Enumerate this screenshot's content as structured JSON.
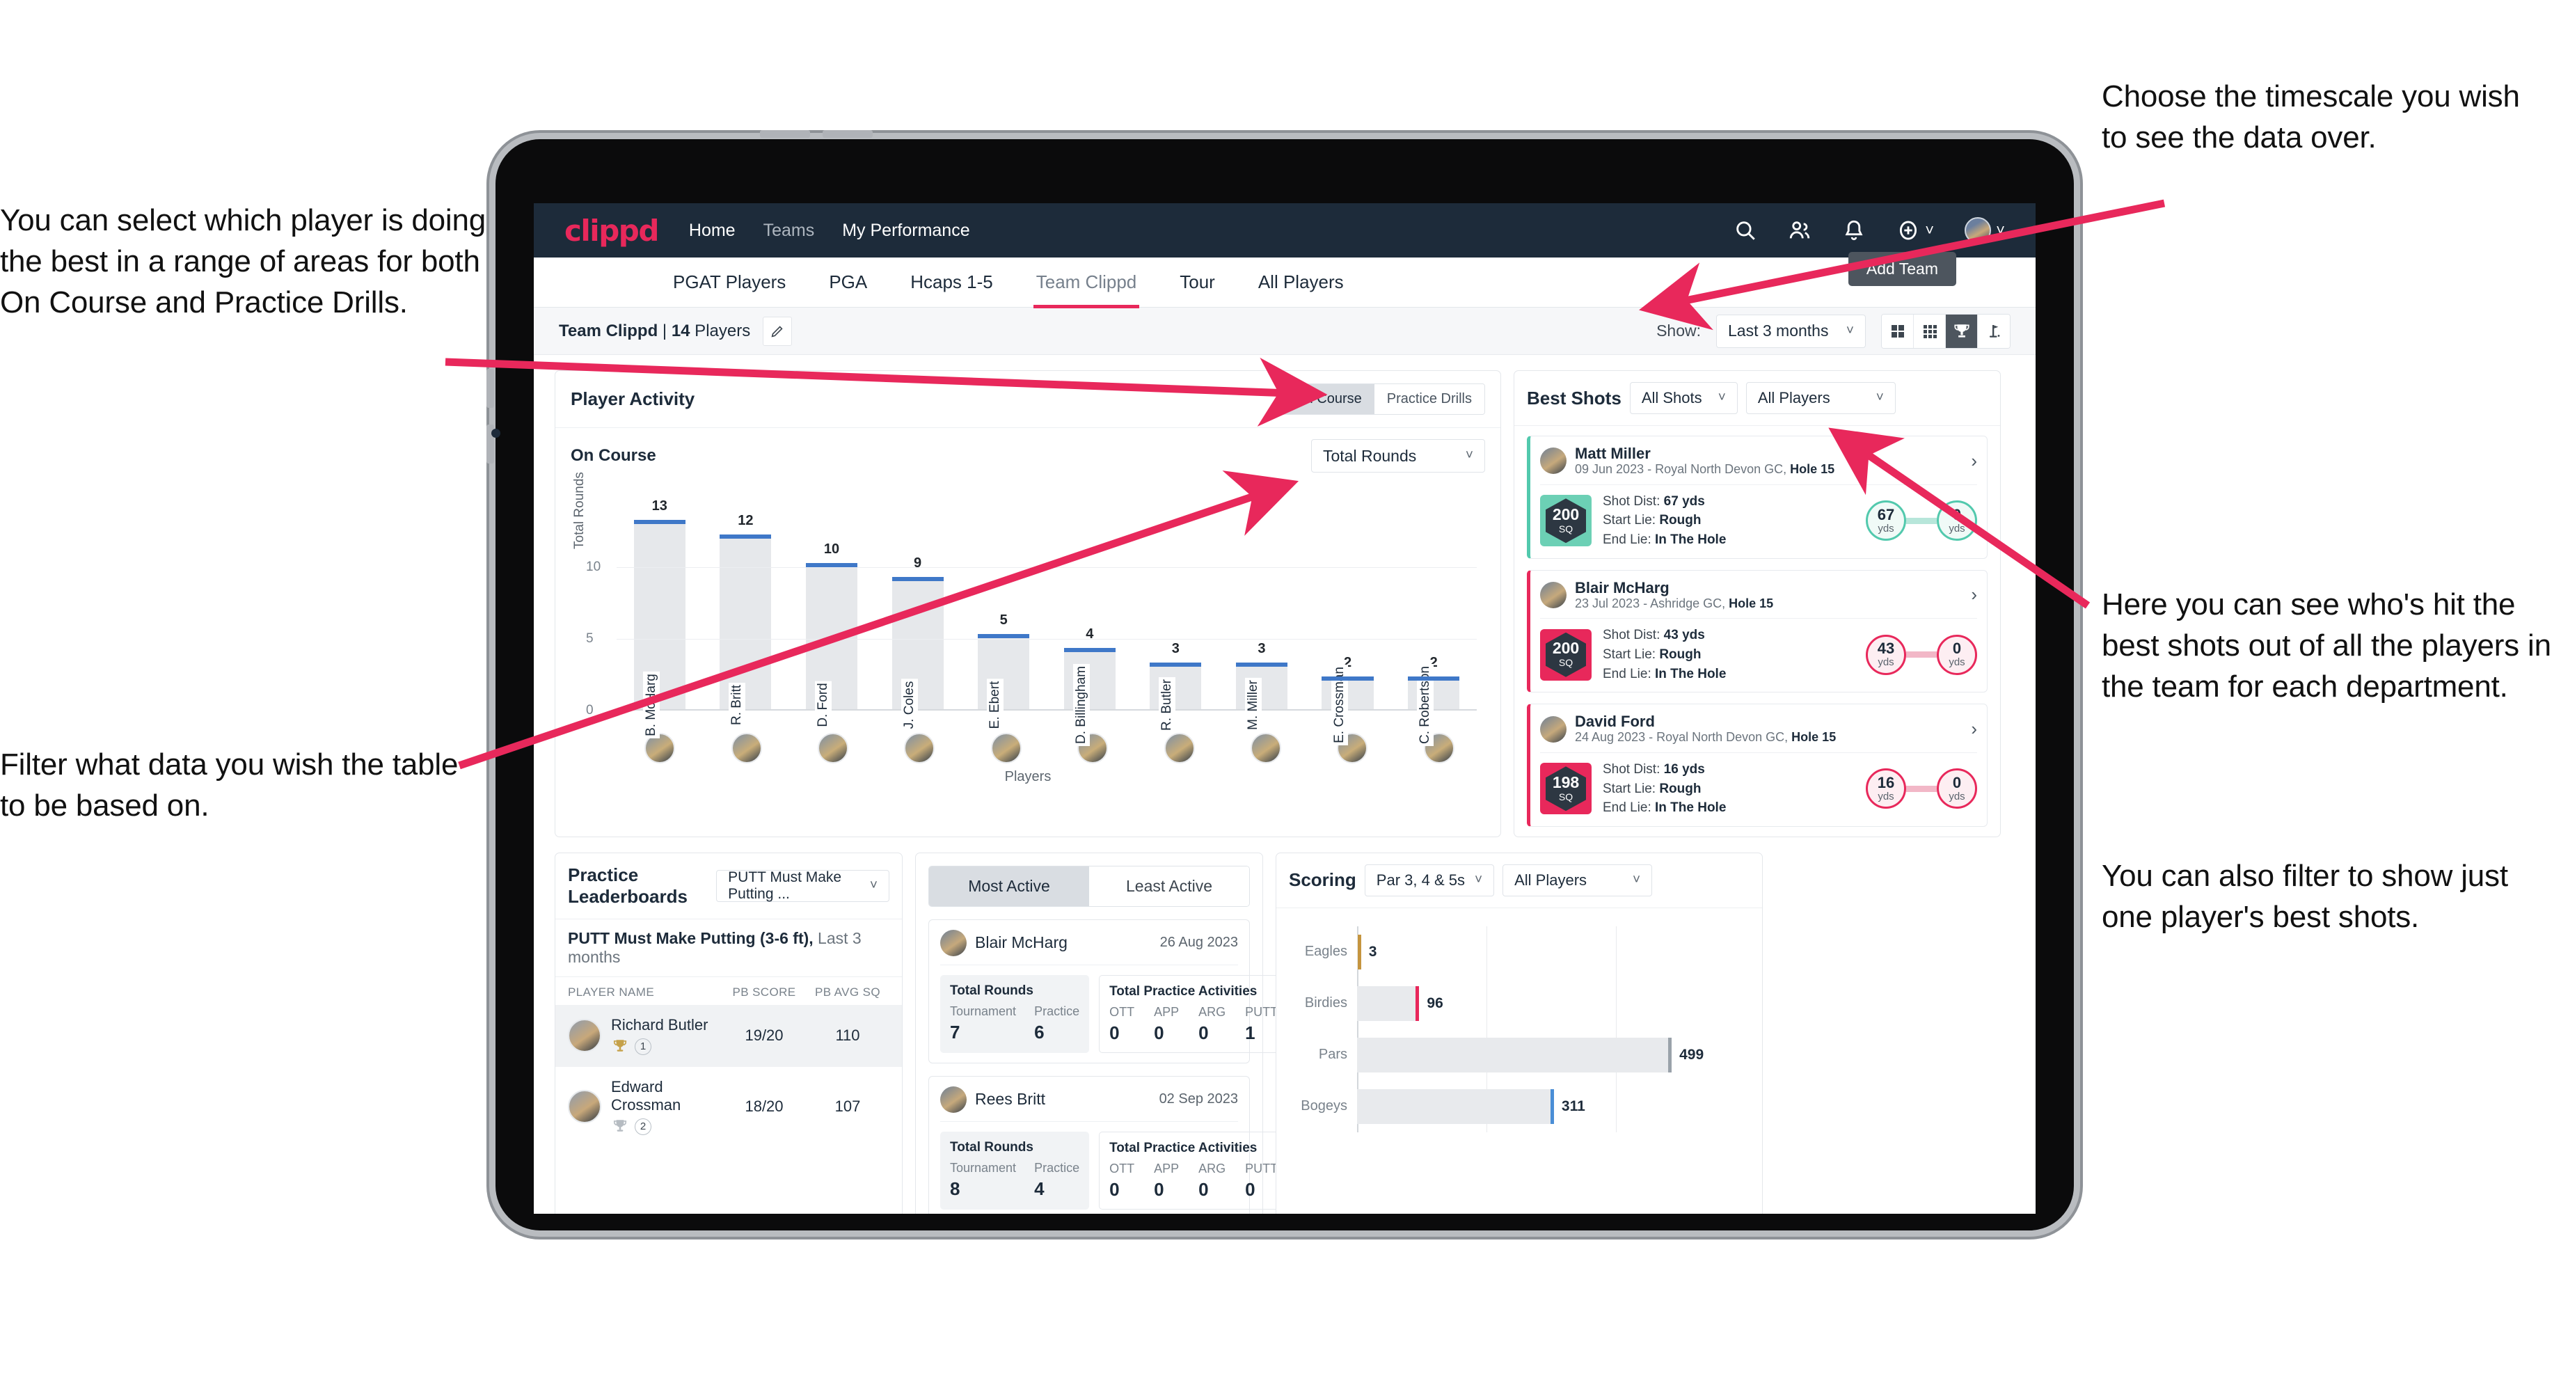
{
  "annotations": {
    "left_top": "You can select which player is doing the best in a range of areas for both On Course and Practice Drills.",
    "left_bottom": "Filter what data you wish the table to be based on.",
    "right_top": "Choose the timescale you wish to see the data over.",
    "right_mid": "Here you can see who's hit the best shots out of all the players in the team for each department.",
    "right_bottom": "You can also filter to show just one player's best shots."
  },
  "app": {
    "logo": "clippd",
    "nav": [
      {
        "label": "Home",
        "dim": false
      },
      {
        "label": "Teams",
        "dim": true
      },
      {
        "label": "My Performance",
        "dim": false
      }
    ],
    "icons": [
      "search-icon",
      "people-icon",
      "bell-icon",
      "plus-circle-icon",
      "avatar"
    ],
    "tabs": [
      {
        "label": "PGAT Players",
        "active": false
      },
      {
        "label": "PGA",
        "active": false
      },
      {
        "label": "Hcaps 1-5",
        "active": false
      },
      {
        "label": "Team Clippd",
        "active": true
      },
      {
        "label": "Tour",
        "active": false
      },
      {
        "label": "All Players",
        "active": false
      }
    ],
    "add_team_tooltip": "Add Team"
  },
  "subbar": {
    "team_name": "Team Clippd",
    "team_sep": " | ",
    "player_count": "14",
    "players_word": " Players",
    "show_label": "Show:",
    "timescale_value": "Last 3 months",
    "view_modes": [
      "grid-4-icon",
      "grid-9-icon",
      "trophy-icon",
      "flag-icon"
    ],
    "active_view": "trophy-icon"
  },
  "player_activity": {
    "title": "Player Activity",
    "segments": [
      {
        "label": "On Course",
        "active": true
      },
      {
        "label": "Practice Drills",
        "active": false
      }
    ],
    "sub_label": "On Course",
    "metric_value": "Total Rounds"
  },
  "best_shots": {
    "title": "Best Shots",
    "filter_shots": "All Shots",
    "filter_players": "All Players",
    "shots": [
      {
        "player": "Matt Miller",
        "meta_date": "09 Jun 2023 - Royal North Devon GC, ",
        "meta_hole": "Hole 15",
        "badge_num": "200",
        "badge_sq": "SQ",
        "accent": "teal",
        "shot_dist_label": "Shot Dist: ",
        "shot_dist": "67 yds",
        "start_lie_label": "Start Lie: ",
        "start_lie": "Rough",
        "end_lie_label": "End Lie: ",
        "end_lie": "In The Hole",
        "from_val": "67",
        "from_unit": "yds",
        "to_val": "0",
        "to_unit": "yds"
      },
      {
        "player": "Blair McHarg",
        "meta_date": "23 Jul 2023 - Ashridge GC, ",
        "meta_hole": "Hole 15",
        "badge_num": "200",
        "badge_sq": "SQ",
        "accent": "pink",
        "shot_dist_label": "Shot Dist: ",
        "shot_dist": "43 yds",
        "start_lie_label": "Start Lie: ",
        "start_lie": "Rough",
        "end_lie_label": "End Lie: ",
        "end_lie": "In The Hole",
        "from_val": "43",
        "from_unit": "yds",
        "to_val": "0",
        "to_unit": "yds"
      },
      {
        "player": "David Ford",
        "meta_date": "24 Aug 2023 - Royal North Devon GC, ",
        "meta_hole": "Hole 15",
        "badge_num": "198",
        "badge_sq": "SQ",
        "accent": "pink",
        "shot_dist_label": "Shot Dist: ",
        "shot_dist": "16 yds",
        "start_lie_label": "Start Lie: ",
        "start_lie": "Rough",
        "end_lie_label": "End Lie: ",
        "end_lie": "In The Hole",
        "from_val": "16",
        "from_unit": "yds",
        "to_val": "0",
        "to_unit": "yds"
      }
    ]
  },
  "practice_leaderboards": {
    "title": "Practice Leaderboards",
    "drill_select": "PUTT Must Make Putting ...",
    "subtitle_bold": "PUTT Must Make Putting (3-6 ft),",
    "subtitle_rest": " Last 3 months",
    "columns": [
      "PLAYER NAME",
      "PB SCORE",
      "PB AVG SQ"
    ],
    "rows": [
      {
        "name": "Richard Butler",
        "rank": "1",
        "trophy": "gold",
        "pb_score": "19/20",
        "pb_avg_sq": "110",
        "highlight": true
      },
      {
        "name": "Edward Crossman",
        "rank": "2",
        "trophy": "silver",
        "pb_score": "18/20",
        "pb_avg_sq": "107",
        "highlight": false
      }
    ]
  },
  "activity": {
    "tabs": [
      {
        "label": "Most Active",
        "active": true
      },
      {
        "label": "Least Active",
        "active": false
      }
    ],
    "cards": [
      {
        "name": "Blair McHarg",
        "date": "26 Aug 2023",
        "rounds_title": "Total Rounds",
        "rounds": [
          {
            "key": "Tournament",
            "value": "7"
          },
          {
            "key": "Practice",
            "value": "6"
          }
        ],
        "practice_title": "Total Practice Activities",
        "practice": [
          {
            "key": "OTT",
            "value": "0"
          },
          {
            "key": "APP",
            "value": "0"
          },
          {
            "key": "ARG",
            "value": "0"
          },
          {
            "key": "PUTT",
            "value": "1"
          }
        ]
      },
      {
        "name": "Rees Britt",
        "date": "02 Sep 2023",
        "rounds_title": "Total Rounds",
        "rounds": [
          {
            "key": "Tournament",
            "value": "8"
          },
          {
            "key": "Practice",
            "value": "4"
          }
        ],
        "practice_title": "Total Practice Activities",
        "practice": [
          {
            "key": "OTT",
            "value": "0"
          },
          {
            "key": "APP",
            "value": "0"
          },
          {
            "key": "ARG",
            "value": "0"
          },
          {
            "key": "PUTT",
            "value": "0"
          }
        ]
      }
    ]
  },
  "scoring": {
    "title": "Scoring",
    "filter_par": "Par 3, 4 & 5s",
    "filter_players": "All Players"
  },
  "chart_data": [
    {
      "type": "bar",
      "title": "Player Activity - On Course",
      "xlabel": "Players",
      "ylabel": "Total Rounds",
      "ylim": [
        0,
        14
      ],
      "yticks": [
        0,
        5,
        10
      ],
      "grid": true,
      "categories": [
        "B. McHarg",
        "R. Britt",
        "D. Ford",
        "J. Coles",
        "E. Ebert",
        "D. Billingham",
        "R. Butler",
        "M. Miller",
        "E. Crossman",
        "C. Robertson"
      ],
      "values": [
        13,
        12,
        10,
        9,
        5,
        4,
        3,
        3,
        2,
        2
      ],
      "bar_color": "#e6e8eb",
      "cap_color": "#3f78c8"
    },
    {
      "type": "bar",
      "orientation": "horizontal",
      "title": "Scoring",
      "xlabel": "",
      "ylabel": "",
      "xlim": [
        0,
        620
      ],
      "categories": [
        "Eagles",
        "Birdies",
        "Pars",
        "Bogeys"
      ],
      "values": [
        3,
        96,
        499,
        311
      ],
      "colors": [
        "#c5953f",
        "#e8285b",
        "#9aa2aa",
        "#4a8ed6"
      ]
    }
  ]
}
